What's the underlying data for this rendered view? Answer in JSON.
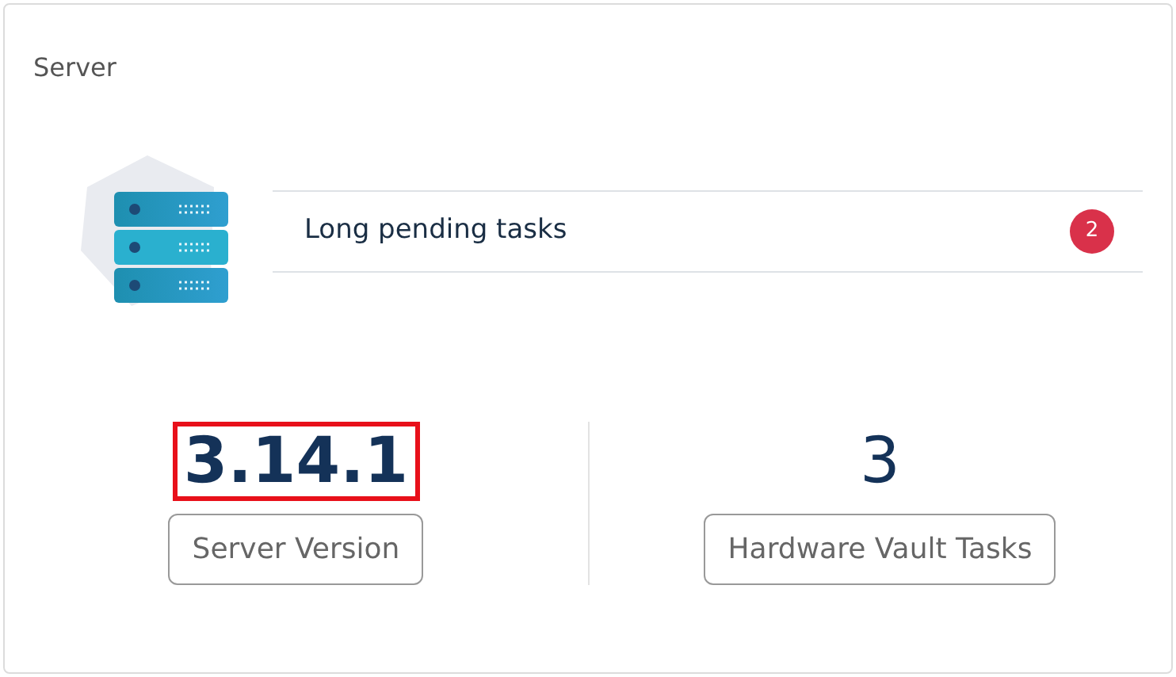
{
  "card": {
    "title": "Server"
  },
  "tasks": [
    {
      "label": "Long pending tasks",
      "count": "2"
    }
  ],
  "stats": [
    {
      "value": "3.14.1",
      "label": "Server Version",
      "highlighted": true,
      "bold": true
    },
    {
      "value": "3",
      "label": "Hardware Vault Tasks",
      "highlighted": false,
      "bold": false
    }
  ]
}
